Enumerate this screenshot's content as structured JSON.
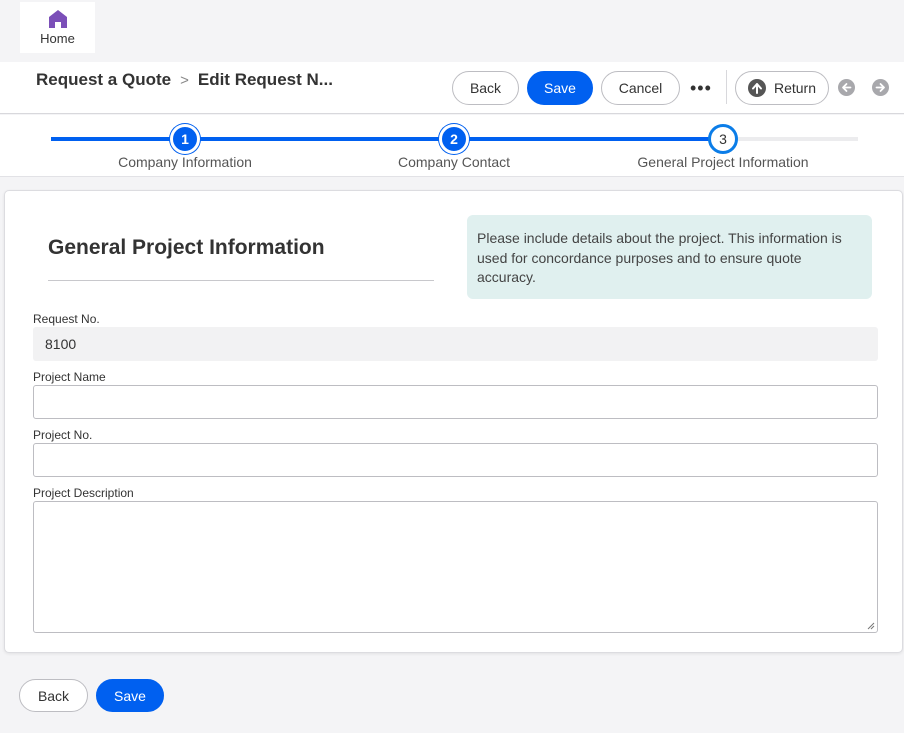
{
  "home": {
    "label": "Home"
  },
  "breadcrumb": {
    "parent": "Request a Quote",
    "separator": ">",
    "current": "Edit Request N..."
  },
  "toolbar": {
    "back_label": "Back",
    "save_label": "Save",
    "cancel_label": "Cancel",
    "more_label": "•••",
    "return_label": "Return"
  },
  "steps": [
    {
      "number": "1",
      "label": "Company Information",
      "state": "done"
    },
    {
      "number": "2",
      "label": "Company Contact",
      "state": "done"
    },
    {
      "number": "3",
      "label": "General Project Information",
      "state": "current"
    }
  ],
  "section": {
    "title": "General Project Information",
    "info": "Please include details about the project. This information is used for concordance purposes and to ensure quote accuracy."
  },
  "fields": {
    "request_no": {
      "label": "Request No.",
      "value": "8100"
    },
    "project_name": {
      "label": "Project Name",
      "value": ""
    },
    "project_no": {
      "label": "Project No.",
      "value": ""
    },
    "project_description": {
      "label": "Project Description",
      "value": ""
    }
  },
  "footer": {
    "back_label": "Back",
    "save_label": "Save"
  },
  "colors": {
    "primary": "#0060f0",
    "current_step_ring": "#0b7de8",
    "home_icon": "#7b4fb8",
    "info_bg": "#e0f0ef"
  },
  "icons": {
    "home": "home-icon",
    "return": "arrow-up-circle-icon",
    "prev": "arrow-left-circle-icon",
    "next": "arrow-right-circle-icon"
  }
}
